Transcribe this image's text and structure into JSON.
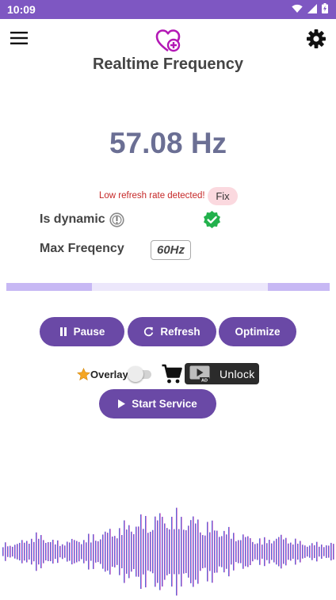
{
  "status_bar": {
    "time": "10:09",
    "wifi_icon": "wifi-icon",
    "signal_icon": "signal-icon",
    "battery_icon": "battery-charging-icon"
  },
  "header": {
    "menu_icon": "menu-icon",
    "logo_icon": "heart-plus-icon",
    "settings_icon": "gear-icon",
    "title": "Realtime Frequency"
  },
  "reading": {
    "frequency": "57.08 Hz"
  },
  "warning": {
    "text": "Low refresh rate detected!",
    "fix_label": "Fix"
  },
  "info": {
    "dynamic_label": "Is dynamic",
    "dynamic_info_icon": "info-icon",
    "dynamic_status_icon": "verified-check-icon",
    "max_label": "Max Freqency",
    "max_value": "60Hz"
  },
  "progress": {
    "segments": [
      {
        "start": 0.0,
        "end": 0.265
      },
      {
        "start": 0.81,
        "end": 1.0
      }
    ]
  },
  "controls": {
    "pause_label": "Pause",
    "refresh_label": "Refresh",
    "optimize_label": "Optimize"
  },
  "overlay": {
    "star_icon": "star-icon",
    "label": "Overlay",
    "enabled": false,
    "cart_icon": "cart-icon",
    "unlock_label": "Unlock",
    "ad_badge": "AD"
  },
  "service": {
    "start_label": "Start Service"
  },
  "colors": {
    "accent": "#6a49a6",
    "status_bar": "#7e57c2",
    "frequency": "#6b6f94",
    "warning": "#c62828",
    "progress_fill": "#c7b8f4",
    "progress_track": "#ece7fb"
  }
}
